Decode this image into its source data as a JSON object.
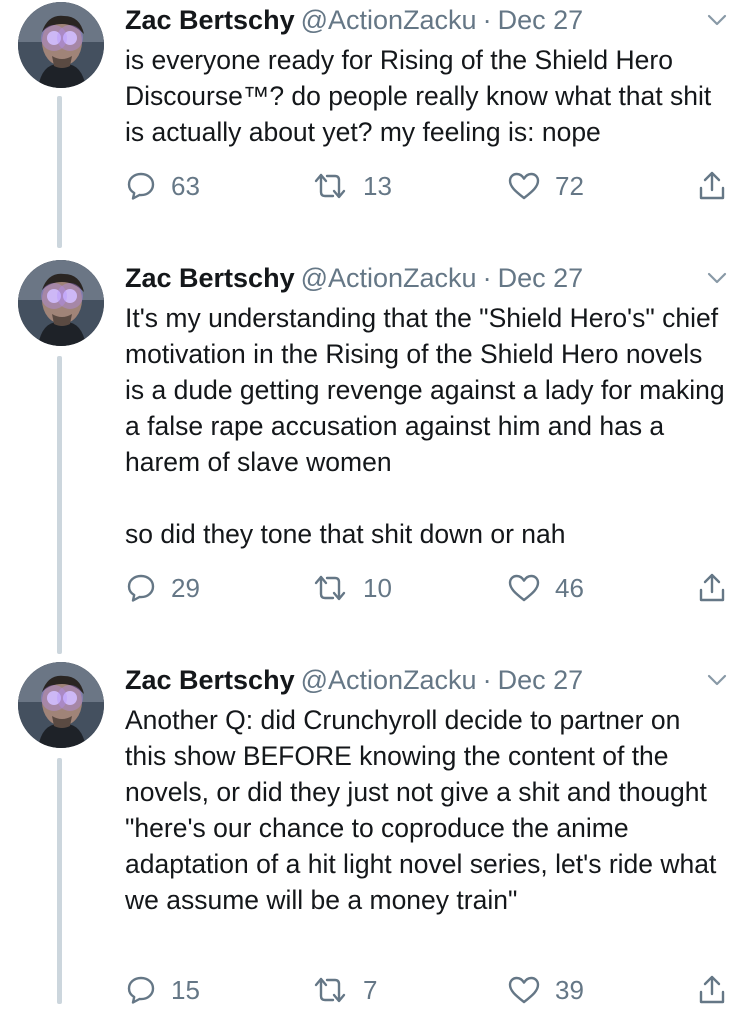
{
  "tweets": [
    {
      "display_name": "Zac Bertschy",
      "handle": "@ActionZacku",
      "separator": "·",
      "date": "Dec 27",
      "text": "is everyone ready for Rising of the Shield Hero Discourse™? do people really know what that shit is actually about yet? my feeling is: nope",
      "replies": "63",
      "retweets": "13",
      "likes": "72"
    },
    {
      "display_name": "Zac Bertschy",
      "handle": "@ActionZacku",
      "separator": "·",
      "date": "Dec 27",
      "text": "It's my understanding that the \"Shield Hero's\" chief motivation in the Rising of the Shield Hero novels is a dude getting revenge against a lady for making a false rape accusation against him and has a harem of slave women\n\nso did they tone that shit down or nah",
      "replies": "29",
      "retweets": "10",
      "likes": "46"
    },
    {
      "display_name": "Zac Bertschy",
      "handle": "@ActionZacku",
      "separator": "·",
      "date": "Dec 27",
      "text": "Another Q: did Crunchyroll decide to partner on this show BEFORE knowing the content of the novels, or did they just not give a shit and thought \"here's our chance to coproduce the anime adaptation of a hit light novel series, let's ride what we assume will be a money train\"",
      "replies": "15",
      "retweets": "7",
      "likes": "39"
    }
  ],
  "icons": {
    "reply": "reply-icon",
    "retweet": "retweet-icon",
    "like": "heart-icon",
    "share": "share-icon",
    "caret": "chevron-down-icon"
  },
  "colors": {
    "text": "#14171a",
    "secondary": "#657786",
    "thread_line": "#ccd6dd"
  }
}
